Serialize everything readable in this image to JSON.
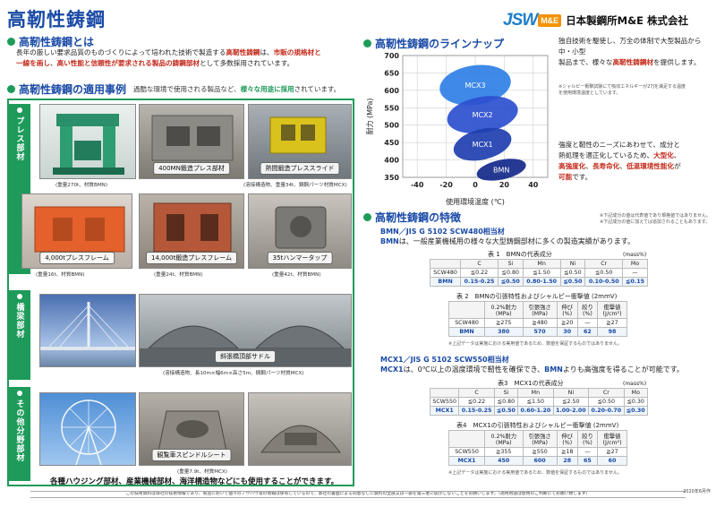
{
  "header": {
    "title": "高靭性鋳鋼",
    "logo": {
      "jsw": "JSW",
      "me": "M&E",
      "company": "日本製鋼所M&E 株式会社"
    }
  },
  "about": {
    "heading": "高靭性鋳鋼とは",
    "line1_a": "長年の厳しい要求品質のものづくりによって培われた技術で製造する",
    "line1_b": "高靭性鋳鋼",
    "line1_c": "は、",
    "line1_d": "市販の規格材と",
    "line2_a": "一線を画し",
    "line2_b": "、",
    "line2_c": "高い性能と信頼性が要求される製品の鋳鋼部材",
    "line2_d": "として多数採用されています。"
  },
  "cases": {
    "heading": "高靭性鋳鋼の適用事例",
    "note_a": "過酷な環境で使用される製品など、",
    "note_b": "様々な用途に採用",
    "note_c": "されています。",
    "tabs": [
      "プレス部材",
      "橋梁部材",
      "その他分野部材"
    ],
    "photos": [
      {
        "caption": "",
        "sub": "(重量270t、材質BMN)"
      },
      {
        "caption": "400MN鍛造プレス部材",
        "sub": ""
      },
      {
        "caption": "熱間鍛造プレススライド",
        "sub": "(溶接構造物、重量34t、鋳鋼パーツ材質MCX)"
      },
      {
        "caption": "4,000tプレスフレーム",
        "sub": "(重量16t、材質BMN)"
      },
      {
        "caption": "14,000t鍛造プレスフレーム",
        "sub": "(重量24t、材質BMN)"
      },
      {
        "caption": "35tハンマータップ",
        "sub": "(重量42t、材質BMN)"
      },
      {
        "caption": "",
        "sub": ""
      },
      {
        "caption": "斜張橋頂部サドル",
        "sub": "(溶接構造物、長10m×幅6m×高さ5m、鋳鋼パーツ材質MCX)"
      },
      {
        "caption": "",
        "sub": ""
      },
      {
        "caption": "",
        "sub": ""
      },
      {
        "caption": "観覧車スピンドルシート",
        "sub": "(重量7.9t、材質MCX)"
      },
      {
        "caption": "",
        "sub": ""
      }
    ],
    "bottom_note": "各種ハウジング部材、産業機械部材、海洋構造物などにも使用することができます。"
  },
  "lineup": {
    "heading": "高靭性鋳鋼のラインナップ",
    "text_a": "独自技術を駆使し、万全の体制で大型製品から中・小型",
    "text_b": "製品まで、様々な",
    "text_c": "高靭性鋳鋼材",
    "text_d": "を提供します。",
    "tiny": [
      "※シャルピー衝撃試験にて吸収エネルギーが27Jを満足する温度",
      "を使用環境温度としています。"
    ],
    "text2_a": "強度と靭性のニーズにあわせて、成分と",
    "text2_b": "熱処理を適正化しているため、",
    "text2_c": "大型化",
    "text2_d": "、",
    "text2_e": "高強度化",
    "text2_f": "、",
    "text2_g": "長寿命化",
    "text2_h": "、",
    "text2_i": "低温環境性能化",
    "text2_j": "が",
    "text2_k": "可能",
    "text2_l": "です。"
  },
  "chart_data": {
    "type": "scatter",
    "ylabel": "耐力 (MPa)",
    "xlabel": "使用環境温度 (℃)",
    "xlim": [
      -50,
      50
    ],
    "ylim": [
      350,
      700
    ],
    "xticks": [
      -40,
      -20,
      0,
      20,
      40
    ],
    "yticks": [
      350,
      400,
      450,
      500,
      550,
      600,
      650,
      700
    ],
    "grid": true,
    "series": [
      {
        "name": "MCX3",
        "x": 0,
        "y": 615,
        "color": "#2f7fe6"
      },
      {
        "name": "MCX2",
        "x": 5,
        "y": 530,
        "color": "#2c4fcf"
      },
      {
        "name": "MCX1",
        "x": 5,
        "y": 445,
        "color": "#1e3fb0"
      },
      {
        "name": "BMN",
        "x": 18,
        "y": 372,
        "color": "#14288a"
      }
    ]
  },
  "features": {
    "heading": "高靭性鋳鋼の特徴",
    "notes": [
      "※下記成分の値は代表値であり規格値ではありません。",
      "※下記成分の値に加えては追加されることもあります。"
    ],
    "bmn": {
      "title": "BMN／JIS G 5102 SCW480相当材",
      "desc_a": "BMN",
      "desc_b": "は、一般産業機械用の様々な大型鋳鋼部材に多くの製造実績があります。",
      "t1_title": "表 1　BMNの代表成分",
      "t1_unit": "(mass%)",
      "t1_head": [
        "",
        "C",
        "Si",
        "Mn",
        "Ni",
        "Cr",
        "Mo"
      ],
      "t1_rows": [
        [
          "SCW480",
          "≦0.22",
          "≦0.80",
          "≦1.50",
          "≦0.50",
          "≦0.50",
          "—"
        ],
        [
          "BMN",
          "0.15-0.25",
          "≦0.50",
          "0.80-1.50",
          "≦0.50",
          "0.10-0.50",
          "≦0.15"
        ]
      ],
      "t2_title": "表 2　BMNの引張特性およびシャルピー衝撃値 (2mmV)",
      "t2_head": [
        "",
        "0.2%耐力\n(MPa)",
        "引張強さ\n(MPa)",
        "伸び\n(%)",
        "絞り\n(%)",
        "衝撃値\n(J/cm²)"
      ],
      "t2_rows": [
        [
          "SCW480",
          "≧275",
          "≧480",
          "≧20",
          "—",
          "≧27"
        ],
        [
          "BMN",
          "380",
          "570",
          "30",
          "62",
          "98"
        ]
      ],
      "t2_note": "※上記データは実施における実用値であるため、数値を保証するものではありません。"
    },
    "mcx": {
      "title": "MCX1／JIS G 5102 SCW550相当材",
      "desc_a": "MCX1",
      "desc_b": "は、0℃以上の温度環境で靭性を確保でき、",
      "desc_c": "BMN",
      "desc_d": "よりも高強度を得ることが可能です。",
      "t3_title": "表3　MCX1の代表成分",
      "t3_unit": "(mass%)",
      "t3_head": [
        "",
        "C",
        "Si",
        "Mn",
        "Ni",
        "Cr",
        "Mo"
      ],
      "t3_rows": [
        [
          "SCW550",
          "≦0.22",
          "≦0.80",
          "≦1.50",
          "≦2.50",
          "≦0.50",
          "≦0.30"
        ],
        [
          "MCX1",
          "0.15-0.25",
          "≦0.50",
          "0.60-1.20",
          "1.00-2.00",
          "0.20-0.70",
          "≦0.30"
        ]
      ],
      "t4_title": "表4　MCX1の引張特性およびシャルピー衝撃値 (2mmV)",
      "t4_head": [
        "",
        "0.2%耐力\n(MPa)",
        "引張強さ\n(MPa)",
        "伸び\n(%)",
        "絞り\n(%)",
        "衝撃値\n(J/cm²)"
      ],
      "t4_rows": [
        [
          "SCW550",
          "≧355",
          "≧550",
          "≧18",
          "—",
          "≧27"
        ],
        [
          "MCX1",
          "450",
          "600",
          "28",
          "65",
          "60"
        ]
      ],
      "t4_note": "※上記データは実施における実用値であるため、数値を保証するものではありません。"
    }
  },
  "footer": {
    "disclaimer": "この技術資料は弊社の技術情報であり、製造において個々のノウハウ等の情報は保有しているので、弊社の書面による同意なしに資料の全部又は一部を第三者に開示しないことをお願いします。（適用用途は使用のご判断にてお願い致します）",
    "code": "2020年6月作"
  },
  "colors": {
    "accent": "#1a4aa6",
    "green": "#1e9b5a",
    "red": "#c42b1c",
    "orange": "#f39200"
  }
}
